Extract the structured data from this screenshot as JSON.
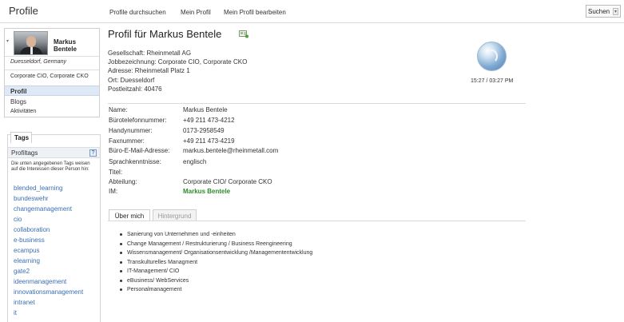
{
  "header": {
    "app_title": "Profile",
    "nav": [
      "Profile durchsuchen",
      "Mein Profil",
      "Mein Profil bearbeiten"
    ],
    "search_label": "Suchen"
  },
  "sidebar": {
    "name": "Markus Bentele",
    "location": "Duesseldorf, Germany",
    "job_title": "Corporate CIO, Corporate CKO",
    "nav": [
      "Profil",
      "Blogs",
      "Aktivitäten"
    ],
    "active_nav": "Profil"
  },
  "tags": {
    "tab_label": "Tags",
    "section_label": "Profiltags",
    "help_label": "?",
    "description": "Die unten angegebenen Tags weisen auf die Interessen dieser Person hin:",
    "items": [
      "blended_learning",
      "bundeswehr",
      "changemanagement",
      "cio",
      "collaboration",
      "e-business",
      "ecampus",
      "elearning",
      "gate2",
      "ideenmanagement",
      "innovationsmanagement",
      "intranet",
      "it"
    ]
  },
  "profile": {
    "title": "Profil für Markus Bentele",
    "company_lines": [
      "Gesellschaft: Rheinmetall AG",
      "Jobbezeichnung: Corporate CIO, Corporate CKO",
      "Adresse: Rheinmetall Platz 1",
      "Ort: Duesseldorf",
      "Postleitzahl: 40476"
    ],
    "local_time": "15:27 / 03:27 PM",
    "fields": [
      {
        "label": "Name:",
        "value": "Markus Bentele"
      },
      {
        "label": "Bürotelefonnummer:",
        "value": "+49 211 473-4212"
      },
      {
        "label": "Handynummer:",
        "value": "0173-2958549"
      },
      {
        "label": "Faxnummer:",
        "value": "+49 211 473-4219"
      },
      {
        "label": "Büro-E-Mail-Adresse:",
        "value": "markus.bentele@rheinmetall.com"
      },
      {
        "label": "Sprachkenntnisse:",
        "value": "englisch"
      },
      {
        "label": "Titel:",
        "value": ""
      },
      {
        "label": "Abteilung:",
        "value": "Corporate CIO/ Corporate CKO"
      },
      {
        "label": "IM:",
        "value": "Markus Bentele"
      }
    ],
    "tabs": [
      "Über mich",
      "Hintergrund"
    ],
    "active_tab": "Über mich",
    "about_items": [
      "Sanierung von Unternehmen und -einheiten",
      "Change Management / Restrukturierung / Business Reengineering",
      "Wissensmanagement/ Organisationsentwicklung /Managemententwicklung",
      "Transkulturelles Managment",
      "IT-Management/ CIO",
      "eBusiness/ WebServices",
      "Personalmanagement"
    ]
  },
  "colors": {
    "accent_blue": "#3a6fb5",
    "im_green": "#2e8b2e",
    "active_nav_bg": "#dfe9f5"
  }
}
